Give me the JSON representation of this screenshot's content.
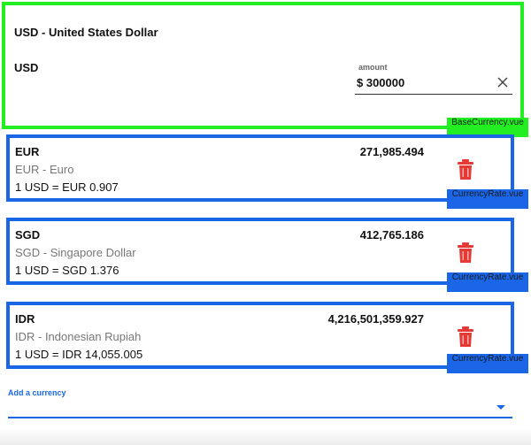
{
  "base": {
    "title": "USD - United States Dollar",
    "code": "USD",
    "amount_label": "amount",
    "amount_value": "$ 300000",
    "component_tag": "BaseCurrency.vue"
  },
  "rates": [
    {
      "code": "EUR",
      "name": "EUR - Euro",
      "rate_text": "1 USD = EUR 0.907",
      "converted": "271,985.494",
      "component_tag": "CurrencyRate.vue"
    },
    {
      "code": "SGD",
      "name": "SGD - Singapore Dollar",
      "rate_text": "1 USD = SGD 1.376",
      "converted": "412,765.186",
      "component_tag": "CurrencyRate.vue"
    },
    {
      "code": "IDR",
      "name": "IDR - Indonesian Rupiah",
      "rate_text": "1 USD = IDR 14,055.005",
      "converted": "4,216,501,359.927",
      "component_tag": "CurrencyRate.vue"
    }
  ],
  "add_currency": {
    "label": "Add a currency"
  },
  "colors": {
    "base_outline": "#22ee22",
    "card_outline": "#1a66e6",
    "delete": "#e53935",
    "accent": "#1a66e6"
  },
  "icons": {
    "clear": "close-icon",
    "delete": "trash-icon",
    "dropdown": "caret-down-icon"
  }
}
